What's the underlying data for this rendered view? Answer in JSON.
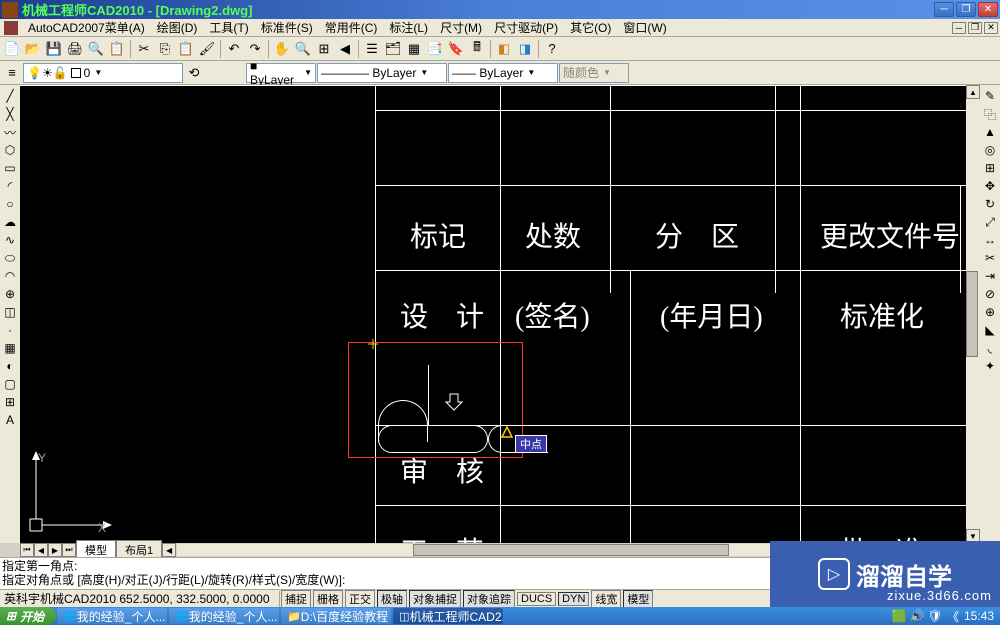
{
  "title": "机械工程师CAD2010 - [Drawing2.dwg]",
  "menus": [
    "AutoCAD2007菜单(A)",
    "绘图(D)",
    "工具(T)",
    "标准件(S)",
    "常用件(C)",
    "标注(L)",
    "尺寸(M)",
    "尺寸驱动(P)",
    "其它(O)",
    "窗口(W)"
  ],
  "layer_dropdown": "0",
  "color_dropdown": "■ ByLayer",
  "linetype_dropdown": "———— ByLayer",
  "lineweight_dropdown": "—— ByLayer",
  "plotstyle_dropdown": "随颜色",
  "table": {
    "r1": [
      "标记",
      "处数",
      "分　区",
      "更改文件号"
    ],
    "r2": [
      "设　计",
      "(签名)",
      "(年月日)",
      "标准化"
    ],
    "r3": [
      "审　核"
    ],
    "r4": [
      "工　艺",
      "批　准"
    ]
  },
  "snap_tooltip": "中点",
  "ucs": {
    "x": "X",
    "y": "Y"
  },
  "model_tabs": [
    "模型",
    "布局1"
  ],
  "command_lines": [
    "指定第一角点:",
    "指定对角点或 [高度(H)/对正(J)/行距(L)/旋转(R)/样式(S)/宽度(W)]:"
  ],
  "status_left": "英科宇机械CAD2010  652.5000, 332.5000, 0.0000",
  "status_toggles": [
    "捕捉",
    "栅格",
    "正交",
    "极轴",
    "对象捕捉",
    "对象追踪",
    "DUCS",
    "DYN",
    "线宽",
    "模型"
  ],
  "taskbar": {
    "start": "开始",
    "items": [
      "我的经验_个人...",
      "我的经验_个人...",
      "D:\\百度经验教程",
      "机械工程师CAD2..."
    ],
    "time": "15:43"
  },
  "watermark": {
    "text": "溜溜自学",
    "url": "zixue.3d66.com"
  }
}
